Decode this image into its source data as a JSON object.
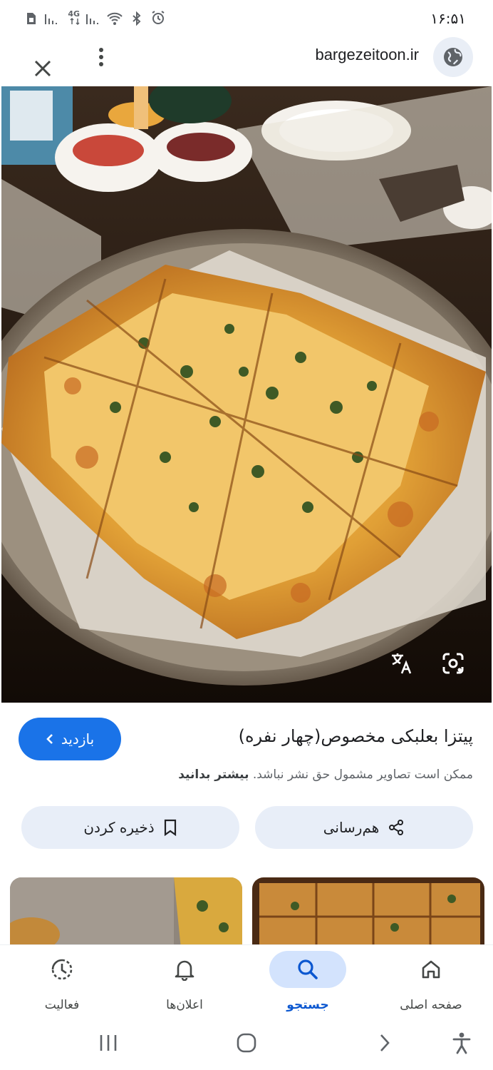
{
  "status_bar": {
    "time": "۱۶:۵۱",
    "network_label": "4G",
    "icons": [
      "sim-icon",
      "signal-icon",
      "network-4g-icon",
      "signal-icon",
      "wifi-icon",
      "bluetooth-icon",
      "alarm-icon"
    ]
  },
  "top_bar": {
    "domain": "bargezeitoon.ir",
    "close_icon": "close-icon",
    "more_icon": "more-vert-icon",
    "site_icon": "globe-icon"
  },
  "hero_image": {
    "subject": "pizza-photo",
    "tools": [
      "translate-icon",
      "lens-icon"
    ]
  },
  "info": {
    "visit_label": "بازدید",
    "title": "پیتزا بعلبکی مخصوص(چهار نفره)",
    "copyright_text": "ممکن است تصاویر مشمول حق نشر نباشد.",
    "learn_more": "بیشتر بدانید",
    "share_label": "هم‌رسانی",
    "save_label": "ذخیره کردن"
  },
  "bottom_nav": {
    "items": [
      {
        "label": "صفحه اصلی",
        "icon": "home-icon",
        "active": false
      },
      {
        "label": "جستجو",
        "icon": "search-icon",
        "active": true
      },
      {
        "label": "اعلان‌ها",
        "icon": "bell-icon",
        "active": false
      },
      {
        "label": "فعالیت",
        "icon": "activity-icon",
        "active": false
      }
    ]
  },
  "colors": {
    "accent": "#1a73e8",
    "pill_bg": "#e8eef8",
    "active_nav_bg": "#d3e3fd",
    "active_nav_text": "#0b57d0"
  }
}
